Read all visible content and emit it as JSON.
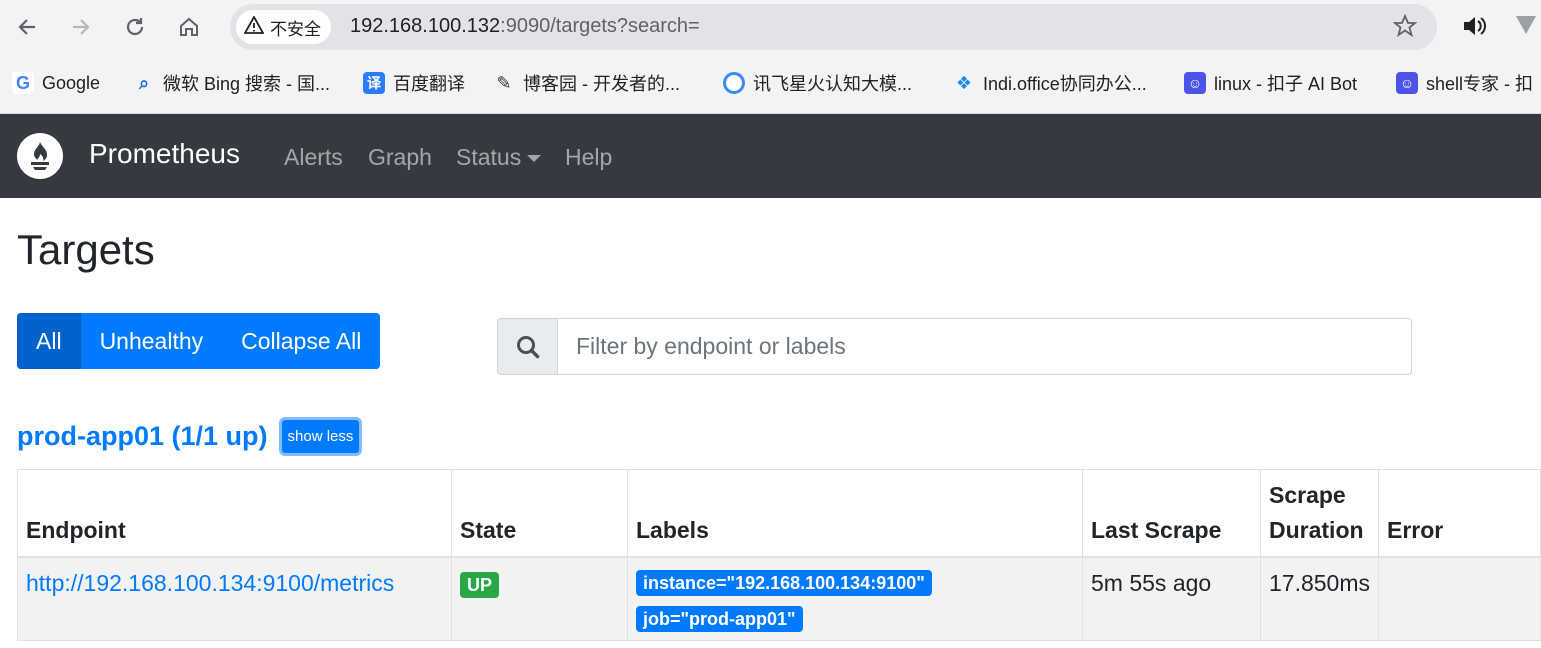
{
  "browser": {
    "security_label": "不安全",
    "url_host": "192.168.100.132",
    "url_rest": ":9090/targets?search=",
    "bookmarks": [
      {
        "label": "Google",
        "icon": "google-icon"
      },
      {
        "label": "微软 Bing 搜索 - 国...",
        "icon": "bing-search-icon"
      },
      {
        "label": "百度翻译",
        "icon": "baidu-translate-icon"
      },
      {
        "label": "博客园 - 开发者的...",
        "icon": "cnblogs-icon"
      },
      {
        "label": "讯飞星火认知大模...",
        "icon": "spark-icon"
      },
      {
        "label": "Indi.office协同办公...",
        "icon": "indi-icon"
      },
      {
        "label": "linux - 扣子 AI Bot",
        "icon": "coze-icon"
      },
      {
        "label": "shell专家 - 扣",
        "icon": "coze-icon"
      }
    ]
  },
  "navbar": {
    "brand": "Prometheus",
    "links": [
      "Alerts",
      "Graph",
      "Status",
      "Help"
    ]
  },
  "page": {
    "title": "Targets",
    "filter_buttons": [
      "All",
      "Unhealthy",
      "Collapse All"
    ],
    "search_placeholder": "Filter by endpoint or labels"
  },
  "job": {
    "title": "prod-app01 (1/1 up)",
    "toggle_label": "show less",
    "columns": [
      "Endpoint",
      "State",
      "Labels",
      "Last Scrape",
      "Scrape Duration",
      "Error"
    ],
    "rows": [
      {
        "endpoint": "http://192.168.100.134:9100/metrics",
        "state": "UP",
        "labels": [
          "instance=\"192.168.100.134:9100\"",
          "job=\"prod-app01\""
        ],
        "last_scrape": "5m 55s ago",
        "scrape_duration": "17.850ms",
        "error": ""
      }
    ]
  },
  "colors": {
    "primary": "#007bff",
    "success": "#28a745",
    "navbar": "#343a40"
  }
}
